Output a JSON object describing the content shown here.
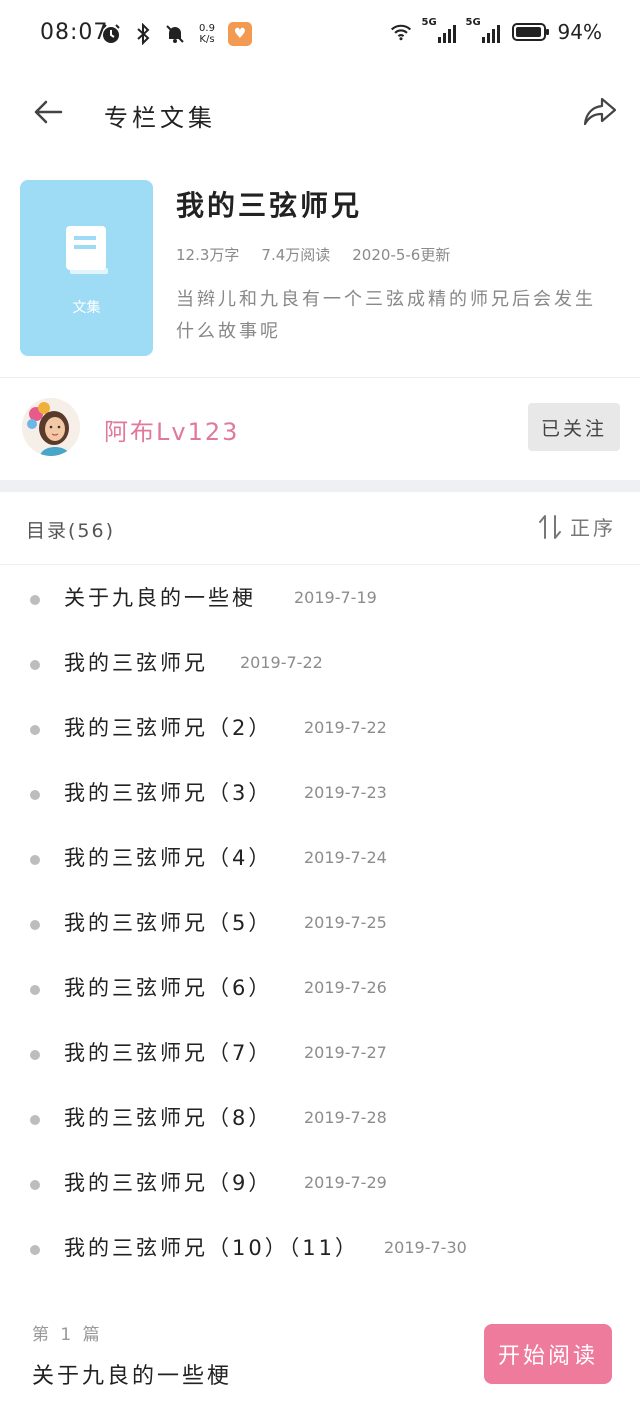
{
  "status_bar": {
    "time": "08:07",
    "net_speed_value": "0.9",
    "net_speed_unit": "K/s",
    "signal1_label": "5G",
    "signal2_label": "5G",
    "battery": "94%",
    "icons": [
      "alarm-icon",
      "bluetooth-icon",
      "mute-bell-icon",
      "app-notification-icon",
      "wifi-icon",
      "signal-icon",
      "battery-icon"
    ]
  },
  "nav": {
    "title": "专栏文集"
  },
  "collection": {
    "cover_label": "文集",
    "title": "我的三弦师兄",
    "word_count": "12.3万字",
    "read_count": "7.4万阅读",
    "updated": "2020-5-6更新",
    "description": "当辫儿和九良有一个三弦成精的师兄后会发生什么故事呢"
  },
  "author": {
    "name": "阿布Lv123",
    "follow_label": "已关注"
  },
  "toc": {
    "title": "目录(56)",
    "sort_label": "正序",
    "items": [
      {
        "title": "关于九良的一些梗",
        "date": "2019-7-19"
      },
      {
        "title": "我的三弦师兄",
        "date": "2019-7-22"
      },
      {
        "title": "我的三弦师兄（2）",
        "date": "2019-7-22"
      },
      {
        "title": "我的三弦师兄（3）",
        "date": "2019-7-23"
      },
      {
        "title": "我的三弦师兄（4）",
        "date": "2019-7-24"
      },
      {
        "title": "我的三弦师兄（5）",
        "date": "2019-7-25"
      },
      {
        "title": "我的三弦师兄（6）",
        "date": "2019-7-26"
      },
      {
        "title": "我的三弦师兄（7）",
        "date": "2019-7-27"
      },
      {
        "title": "我的三弦师兄（8）",
        "date": "2019-7-28"
      },
      {
        "title": "我的三弦师兄（9）",
        "date": "2019-7-29"
      },
      {
        "title": "我的三弦师兄（10）（11）",
        "date": "2019-7-30"
      }
    ]
  },
  "bottom": {
    "current_no": "第 1 篇",
    "current_title": "关于九良的一些梗",
    "start_label": "开始阅读"
  },
  "colors": {
    "accent_pink": "#ee7a9c",
    "author_pink": "#e07a9a",
    "cover_blue": "#9edcf6"
  }
}
